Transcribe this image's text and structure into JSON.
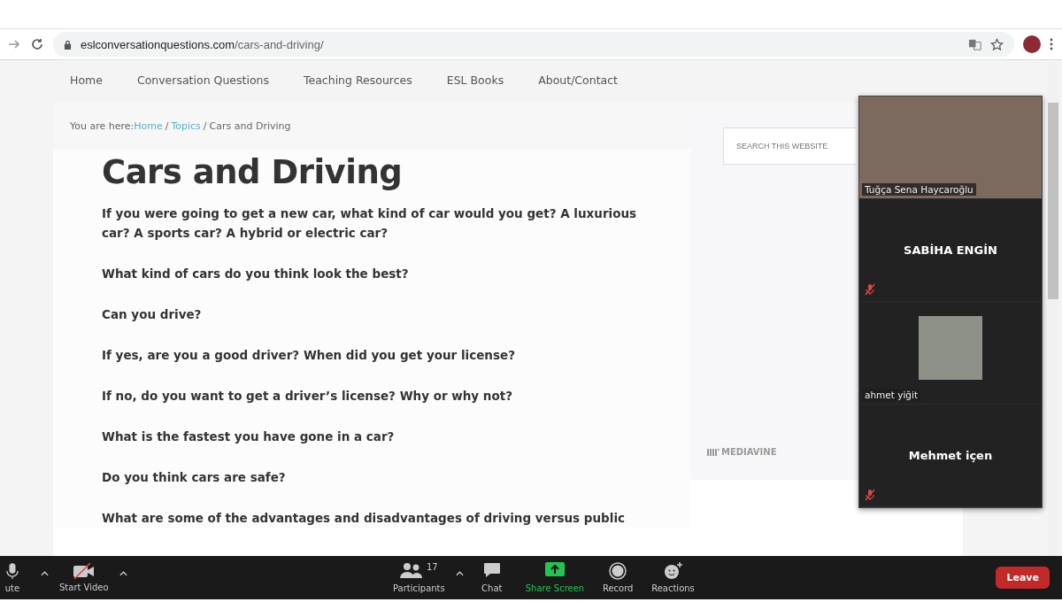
{
  "browser": {
    "url_domain": "eslconversationquestions.com",
    "url_path": "/cars-and-driving/"
  },
  "nav": [
    "Home",
    "Conversation Questions",
    "Teaching Resources",
    "ESL Books",
    "About/Contact"
  ],
  "breadcrumb": {
    "prefix": "You are here:",
    "links": [
      {
        "label": "Home",
        "separator": "/"
      },
      {
        "label": "Topics",
        "separator": "/"
      }
    ],
    "current": "Cars and Driving"
  },
  "article": {
    "title": "Cars and Driving",
    "questions": [
      "If you were going to get a new car, what kind of car would you get? A luxurious car? A sports car? A hybrid or electric car?",
      "What kind of cars do you think look the best?",
      "Can you drive?",
      "If yes, are you a good driver? When did you get your license?",
      "If no, do you want to get a driver’s license? Why or why not?",
      "What is the fastest you have gone in a car?",
      "Do you think cars are safe?",
      "What are some of the advantages and disadvantages of driving versus public"
    ]
  },
  "sidebar": {
    "search": {
      "placeholder": "SEARCH THIS WEBSITE"
    },
    "ad_label": "MEDIAVINE"
  },
  "gallery": [
    {
      "kind": "video",
      "name": "Tuğça Sena Haycaroğlu",
      "muted": false
    },
    {
      "kind": "name",
      "name": "SABİHA ENGİN",
      "muted": true
    },
    {
      "kind": "picture",
      "name": "ahmet yiğit",
      "muted": false
    },
    {
      "kind": "name",
      "name": "Mehmet içen",
      "muted": true
    }
  ],
  "toolbar": {
    "left": [
      {
        "kind": "mic",
        "label": "ute",
        "caret": true
      },
      {
        "kind": "video-off",
        "label": "Start Video",
        "caret": true
      }
    ],
    "center": [
      {
        "kind": "participants",
        "label": "Participants",
        "count": "17",
        "caret": true
      },
      {
        "kind": "chat",
        "label": "Chat",
        "caret": false
      },
      {
        "kind": "share",
        "label": "Share Screen",
        "caret": false
      },
      {
        "kind": "record",
        "label": "Record",
        "caret": false
      },
      {
        "kind": "reactions",
        "label": "Reactions",
        "caret": false
      }
    ],
    "leave": "Leave"
  }
}
